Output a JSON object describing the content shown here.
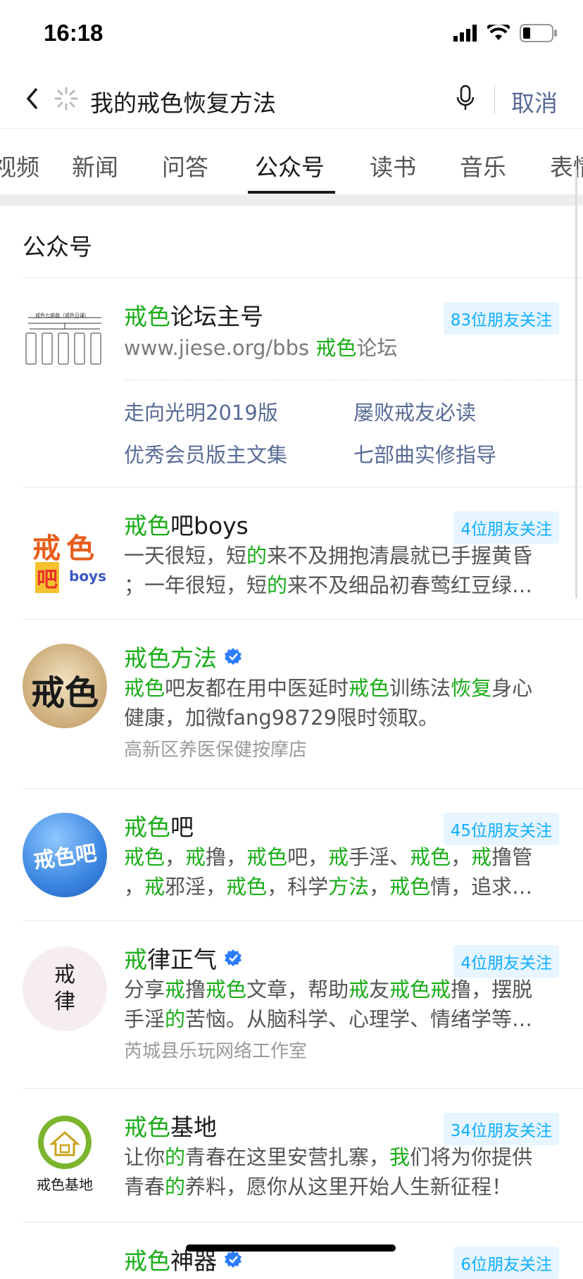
{
  "status": {
    "time": "16:18"
  },
  "search": {
    "query": "我的戒色恢复方法",
    "cancel_label": "取消"
  },
  "tabs": [
    {
      "label": "视频"
    },
    {
      "label": "新闻"
    },
    {
      "label": "问答"
    },
    {
      "label": "公众号",
      "active": true
    },
    {
      "label": "读书"
    },
    {
      "label": "音乐"
    },
    {
      "label": "表情"
    }
  ],
  "section_title": "公众号",
  "results": [
    {
      "name": {
        "hl": "戒色",
        "rest": "论坛主号"
      },
      "friends": "83位朋友关注",
      "url": {
        "pre": "www.jiese.org/bbs ",
        "hl": "戒色",
        "post": "论坛"
      },
      "links": [
        "走向光明2019版",
        "屡败戒友必读",
        "优秀会员版主文集",
        "七部曲实修指导"
      ],
      "avatar_caption": "戒色七部曲（戒色日课）"
    },
    {
      "name": {
        "hl": "戒色",
        "rest": "吧boys"
      },
      "friends": "4位朋友关注",
      "desc": [
        [
          {
            "t": "一天很短，短"
          },
          {
            "t": "的",
            "h": true
          },
          {
            "t": "来不及拥抱清晨就已手握黄昏"
          }
        ],
        [
          {
            "t": "；一年很短，短"
          },
          {
            "t": "的",
            "h": true
          },
          {
            "t": "来不及细品初春莺红豆绿…"
          }
        ]
      ],
      "avatar_text": [
        "戒色",
        "吧",
        "boys"
      ]
    },
    {
      "name": {
        "hl": "戒色方法",
        "rest": ""
      },
      "verified": true,
      "desc": [
        [
          {
            "t": "戒色",
            "h": true
          },
          {
            "t": "吧友都在用中医延时"
          },
          {
            "t": "戒色",
            "h": true
          },
          {
            "t": "训练法"
          },
          {
            "t": "恢复",
            "h": true
          },
          {
            "t": "身心"
          }
        ],
        [
          {
            "t": "健康，加微fang98729限时领取。"
          }
        ]
      ],
      "source": "高新区养医保健按摩店",
      "avatar_text": [
        "戒色"
      ]
    },
    {
      "name": {
        "hl": "戒色",
        "rest": "吧"
      },
      "friends": "45位朋友关注",
      "desc": [
        [
          {
            "t": "戒色",
            "h": true
          },
          {
            "t": "，"
          },
          {
            "t": "戒",
            "h": true
          },
          {
            "t": "撸，"
          },
          {
            "t": "戒色",
            "h": true
          },
          {
            "t": "吧，"
          },
          {
            "t": "戒",
            "h": true
          },
          {
            "t": "手淫、"
          },
          {
            "t": "戒色",
            "h": true
          },
          {
            "t": "，"
          },
          {
            "t": "戒",
            "h": true
          },
          {
            "t": "撸管"
          }
        ],
        [
          {
            "t": "，"
          },
          {
            "t": "戒",
            "h": true
          },
          {
            "t": "邪淫，"
          },
          {
            "t": "戒色",
            "h": true
          },
          {
            "t": "，科学"
          },
          {
            "t": "方法",
            "h": true
          },
          {
            "t": "，"
          },
          {
            "t": "戒色",
            "h": true
          },
          {
            "t": "情，追求…"
          }
        ]
      ],
      "avatar_text": [
        "戒色吧"
      ]
    },
    {
      "name": {
        "hl": "戒",
        "rest": "律正气"
      },
      "verified": true,
      "friends": "4位朋友关注",
      "desc": [
        [
          {
            "t": "分享"
          },
          {
            "t": "戒",
            "h": true
          },
          {
            "t": "撸"
          },
          {
            "t": "戒色",
            "h": true
          },
          {
            "t": "文章，帮助"
          },
          {
            "t": "戒",
            "h": true
          },
          {
            "t": "友"
          },
          {
            "t": "戒色戒",
            "h": true
          },
          {
            "t": "撸，摆脱"
          }
        ],
        [
          {
            "t": "手淫"
          },
          {
            "t": "的",
            "h": true
          },
          {
            "t": "苦恼。从脑科学、心理学、情绪学等…"
          }
        ]
      ],
      "source": "芮城县乐玩网络工作室",
      "avatar_text": [
        "戒",
        "律"
      ]
    },
    {
      "name": {
        "hl": "戒色",
        "rest": "基地"
      },
      "friends": "34位朋友关注",
      "desc": [
        [
          {
            "t": "让你"
          },
          {
            "t": "的",
            "h": true
          },
          {
            "t": "青春在这里安营扎寨，"
          },
          {
            "t": "我",
            "h": true
          },
          {
            "t": "们将为你提供"
          }
        ],
        [
          {
            "t": "青春"
          },
          {
            "t": "的",
            "h": true
          },
          {
            "t": "养料，愿你从这里开始人生新征程！"
          }
        ]
      ],
      "avatar_text": [
        "戒色基地"
      ]
    },
    {
      "name": {
        "hl": "戒色",
        "rest": "神器"
      },
      "verified": true,
      "friends": "6位朋友关注"
    }
  ],
  "colors": {
    "highlight": "#1aad19",
    "link": "#576b95",
    "badge": "#10aeff"
  }
}
